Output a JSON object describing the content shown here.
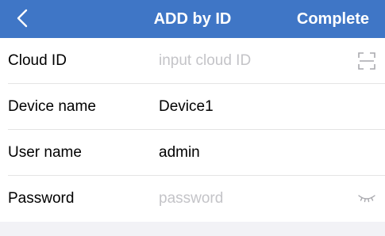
{
  "nav": {
    "back_icon": "chevron-left-icon",
    "title": "ADD by ID",
    "complete_label": "Complete",
    "background": "#3f76c6"
  },
  "form": {
    "cloud_id": {
      "label": "Cloud ID",
      "value": "",
      "placeholder": "input cloud ID",
      "icon": "scan-icon"
    },
    "device_name": {
      "label": "Device name",
      "value": "Device1",
      "placeholder": ""
    },
    "user_name": {
      "label": "User name",
      "value": "admin",
      "placeholder": ""
    },
    "password": {
      "label": "Password",
      "value": "",
      "placeholder": "password",
      "icon": "eye-closed-icon"
    }
  }
}
